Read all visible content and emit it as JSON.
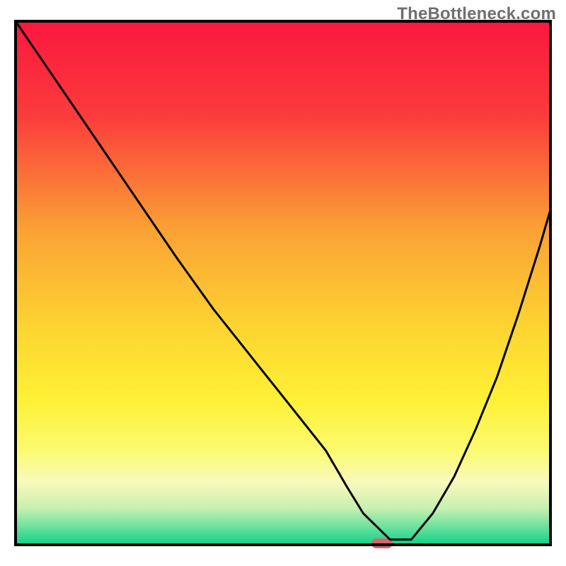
{
  "watermark": "TheBottleneck.com",
  "chart_data": {
    "type": "line",
    "title": "",
    "xlabel": "",
    "ylabel": "",
    "xlim": [
      0,
      100
    ],
    "ylim": [
      0,
      100
    ],
    "grid": false,
    "series": [
      {
        "name": "bottleneck-curve",
        "x": [
          0,
          8,
          16,
          24,
          30,
          37,
          44,
          51,
          58,
          62,
          65,
          68,
          70,
          74,
          78,
          82,
          86,
          90,
          94,
          98,
          100
        ],
        "values": [
          100,
          88,
          76,
          64,
          55,
          45,
          36,
          27,
          18,
          11,
          6,
          3,
          1,
          1,
          6,
          13,
          22,
          32,
          44,
          57,
          64
        ]
      }
    ],
    "annotations": [
      {
        "name": "sweet-spot-marker",
        "x": 68.5,
        "y": 0,
        "color": "#d4666f",
        "shape": "pill"
      }
    ],
    "gradient": {
      "stops": [
        {
          "offset": 0,
          "color": "#fb173e"
        },
        {
          "offset": 18,
          "color": "#fb3b3c"
        },
        {
          "offset": 40,
          "color": "#fba234"
        },
        {
          "offset": 58,
          "color": "#fdd332"
        },
        {
          "offset": 72,
          "color": "#fef034"
        },
        {
          "offset": 82,
          "color": "#fbfb70"
        },
        {
          "offset": 88,
          "color": "#faf9bd"
        },
        {
          "offset": 93,
          "color": "#c7f0ae"
        },
        {
          "offset": 97,
          "color": "#5fe09c"
        },
        {
          "offset": 100,
          "color": "#0fd185"
        }
      ]
    },
    "frame_color": "#000000",
    "curve_color": "#000000",
    "curve_stroke_width": 3
  }
}
